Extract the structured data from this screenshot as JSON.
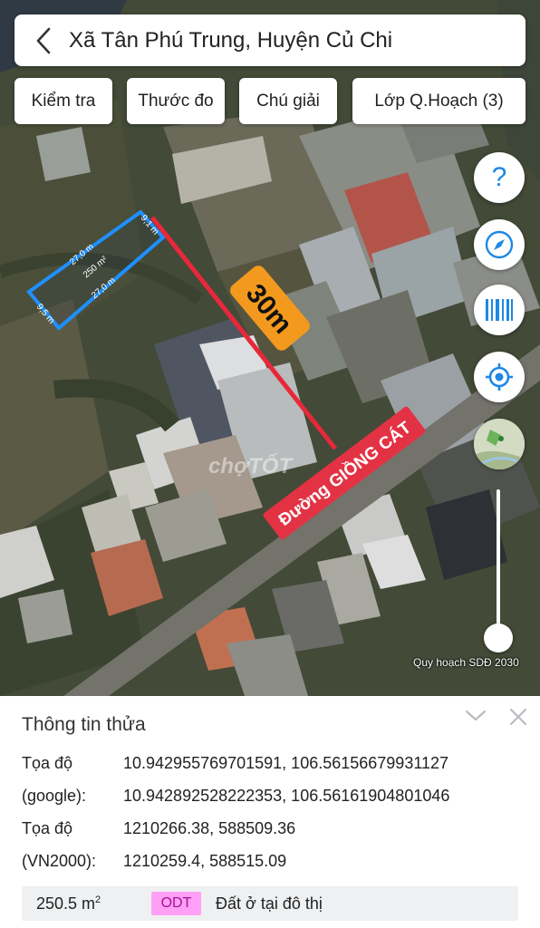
{
  "header": {
    "title": "Xã Tân Phú Trung, Huyện Củ Chi"
  },
  "toolbar": {
    "check_label": "Kiểm tra",
    "measure_label": "Thước đo",
    "legend_label": "Chú giải",
    "layer_label": "Lớp Q.Hoạch (3)"
  },
  "map": {
    "distance_label": "30m",
    "road_label": "Đường GIỒNG CÁT",
    "parcel": {
      "area_label": "250 m²",
      "side_top": "27,0 m",
      "side_bottom": "27,0 m",
      "side_right": "9,1 m",
      "side_left": "9,5 m"
    },
    "watermark": "chợTỐT",
    "plan_label": "Quy hoạch SDĐ 2030",
    "controls": [
      "help-icon",
      "compass-icon",
      "barcode-icon",
      "locate-icon",
      "satellite-thumbnail"
    ],
    "colors": {
      "parcel_outline": "#1e90ff",
      "distance_line": "#e8283a",
      "distance_badge": "#f39a1e",
      "road_badge": "#e33244",
      "control_icon": "#1e88e5"
    }
  },
  "info_panel": {
    "title": "Thông tin thửa",
    "rows": [
      {
        "label": "Tọa độ",
        "value": "10.942955769701591, 106.56156679931127"
      },
      {
        "label": "(google):",
        "value": "10.942892528222353, 106.56161904801046"
      },
      {
        "label": "Tọa độ",
        "value": "1210266.38, 588509.36"
      },
      {
        "label": "(VN2000):",
        "value": "1210259.4, 588515.09"
      }
    ],
    "land": {
      "area_value": "250.5 m",
      "area_unit_sup": "2",
      "code": "ODT",
      "type": "Đất ở tại đô thị",
      "code_color": "#ff9ff6"
    }
  }
}
